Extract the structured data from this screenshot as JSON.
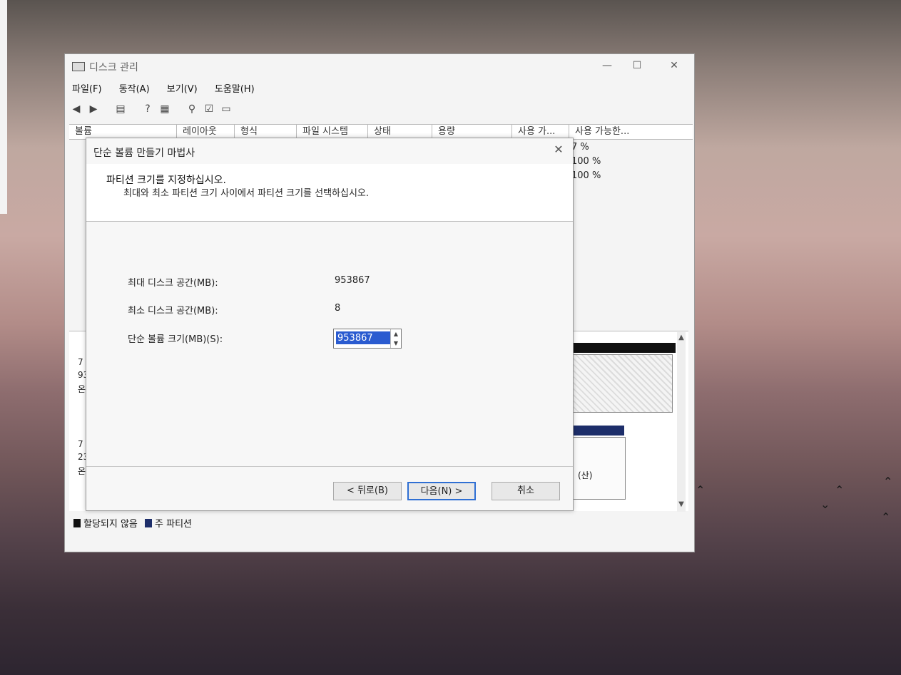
{
  "main_window": {
    "title": "디스크 관리",
    "controls": {
      "minimize": "—",
      "maximize": "☐",
      "close": "✕"
    },
    "menu": [
      "파일(F)",
      "동작(A)",
      "보기(V)",
      "도움말(H)"
    ],
    "columns": [
      "볼륨",
      "레이아웃",
      "형식",
      "파일 시스템",
      "상태",
      "용량",
      "사용 가...",
      "사용 가능한..."
    ],
    "free_percent_rows": [
      "7 %",
      "100 %",
      "100 %"
    ],
    "disk_labels": [
      {
        "line1": "7",
        "line2": "93",
        "line3": "온"
      },
      {
        "line1": "7",
        "line2": "23",
        "line3": "온"
      }
    ],
    "partition_fragment": "(산)",
    "legend": [
      {
        "label": "할당되지 않음",
        "color": "#111111"
      },
      {
        "label": "주 파티션",
        "color": "#1d2e6a"
      }
    ]
  },
  "wizard": {
    "title": "단순 볼륨 만들기 마법사",
    "close_glyph": "✕",
    "heading": "파티션 크기를 지정하십시오.",
    "subheading": "최대와 최소 파티션 크기 사이에서 파티션 크기를 선택하십시오.",
    "max_label": "최대 디스크 공간(MB):",
    "max_value": "953867",
    "min_label": "최소 디스크 공간(MB):",
    "min_value": "8",
    "size_label": "단순 볼륨 크기(MB)(S):",
    "size_value": "953867",
    "buttons": {
      "back": "< 뒤로(B)",
      "next": "다음(N) >",
      "cancel": "취소"
    }
  },
  "colors": {
    "selection": "#2a5bd0",
    "focus_border": "#2f6fd3"
  }
}
